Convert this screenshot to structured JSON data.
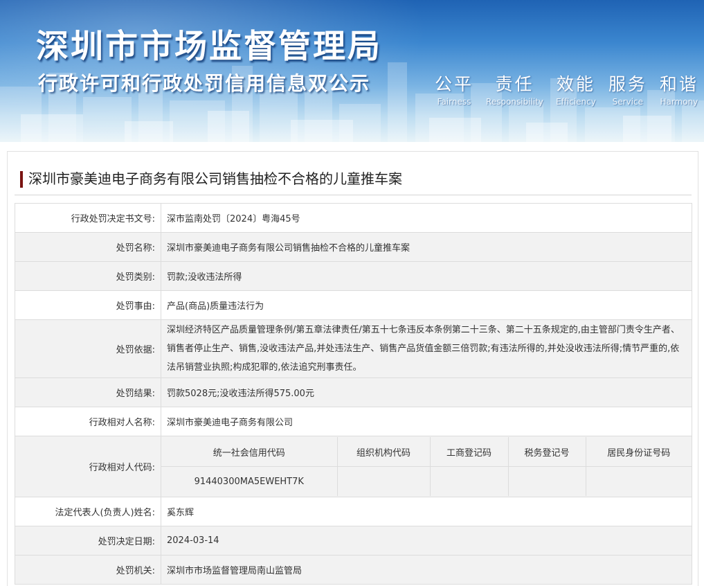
{
  "header": {
    "title": "深圳市市场监督管理局",
    "subtitle": "行政许可和行政处罚信用信息双公示",
    "slogans": [
      {
        "cn": "公平",
        "en": "Fairness"
      },
      {
        "cn": "责任",
        "en": "Responsibility"
      },
      {
        "cn": "效能",
        "en": "Efficiency"
      },
      {
        "cn": "服务",
        "en": "Service"
      },
      {
        "cn": "和谐",
        "en": "Harmony"
      }
    ]
  },
  "case": {
    "heading": "深圳市豪美迪电子商务有限公司销售抽检不合格的儿童推车案",
    "accent_color": "#7a1412",
    "rows": {
      "decision_no": {
        "label": "行政处罚决定书文号:",
        "value": "深市监南处罚〔2024〕粤海45号"
      },
      "name": {
        "label": "处罚名称:",
        "value": "深圳市豪美迪电子商务有限公司销售抽检不合格的儿童推车案"
      },
      "category": {
        "label": "处罚类别:",
        "value": "罚款;没收违法所得"
      },
      "reason": {
        "label": "处罚事由:",
        "value": "产品(商品)质量违法行为"
      },
      "basis": {
        "label": "处罚依据:",
        "value": "深圳经济特区产品质量管理条例/第五章法律责任/第五十七条违反本条例第二十三条、第二十五条规定的,由主管部门责令生产者、销售者停止生产、销售,没收违法产品,并处违法生产、销售产品货值金额三倍罚款;有违法所得的,并处没收违法所得;情节严重的,依法吊销营业执照;构成犯罪的,依法追究刑事责任。"
      },
      "result": {
        "label": "处罚结果:",
        "value": "罚款5028元;没收违法所得575.00元"
      },
      "party_name": {
        "label": "行政相对人名称:",
        "value": "深圳市豪美迪电子商务有限公司"
      },
      "party_code": {
        "label": "行政相对人代码:",
        "headers": [
          "统一社会信用代码",
          "组织机构代码",
          "工商登记码",
          "税务登记号",
          "居民身份证号码"
        ],
        "values": [
          "91440300MA5EWEHT7K",
          "",
          "",
          "",
          ""
        ]
      },
      "legal_rep": {
        "label": "法定代表人(负责人)姓名:",
        "value": "奚东辉"
      },
      "decision_date": {
        "label": "处罚决定日期:",
        "value": "2024-03-14"
      },
      "authority": {
        "label": "处罚机关:",
        "value": "深圳市市场监督管理局南山监管局"
      }
    }
  }
}
